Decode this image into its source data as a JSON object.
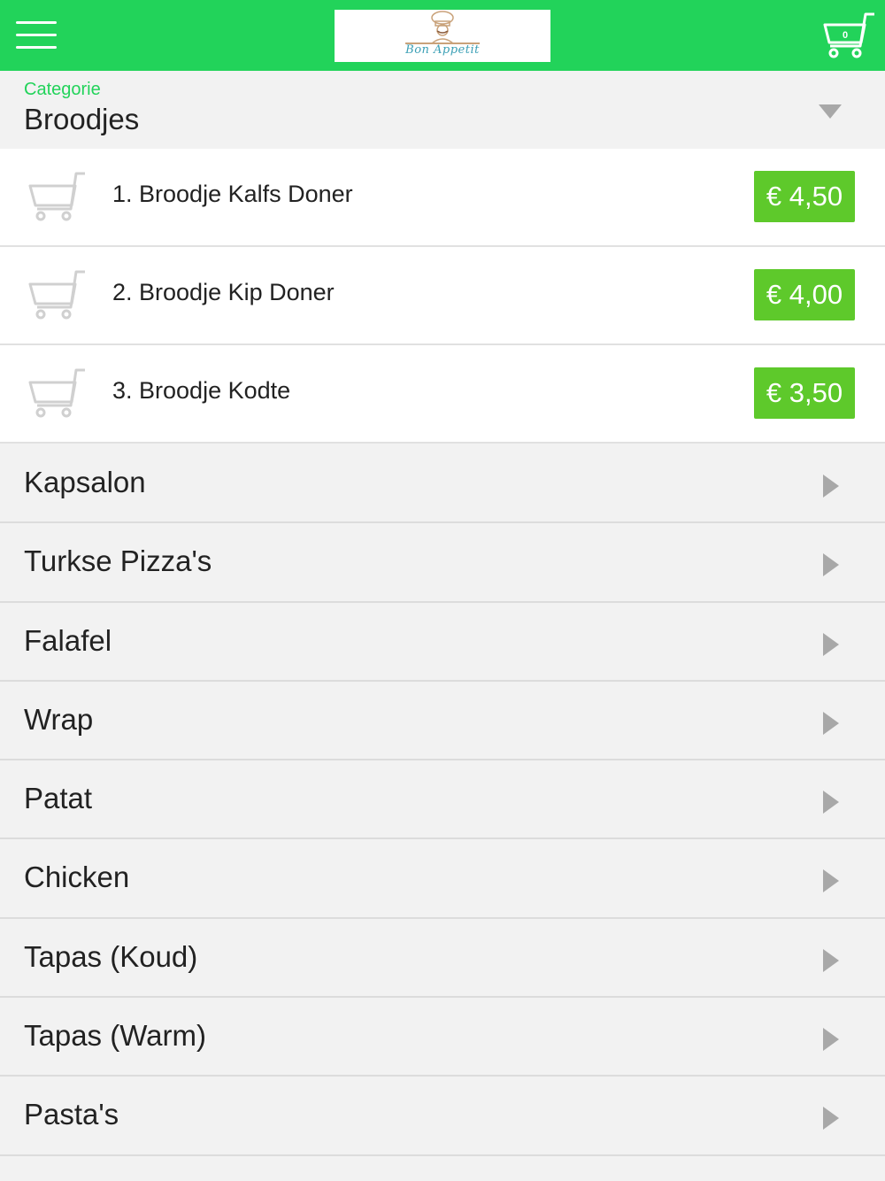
{
  "header": {
    "menu_icon": "hamburger-menu-icon",
    "logo_text": "Bon Appetit",
    "cart_icon": "shopping-cart-icon",
    "cart_count": "0",
    "brand_color": "#22d35a"
  },
  "category_select": {
    "label": "Categorie",
    "value": "Broodjes",
    "icon": "caret-down-icon"
  },
  "products": [
    {
      "name": "1. Broodje Kalfs Doner",
      "price": "€ 4,50"
    },
    {
      "name": "2. Broodje Kip Doner",
      "price": "€ 4,00"
    },
    {
      "name": "3. Broodje Kodte",
      "price": "€ 3,50"
    }
  ],
  "price_color": "#5ec92b",
  "categories": [
    {
      "label": "Kapsalon"
    },
    {
      "label": "Turkse Pizza's"
    },
    {
      "label": "Falafel"
    },
    {
      "label": "Wrap"
    },
    {
      "label": "Patat"
    },
    {
      "label": "Chicken"
    },
    {
      "label": "Tapas (Koud)"
    },
    {
      "label": "Tapas (Warm)"
    },
    {
      "label": "Pasta's"
    }
  ]
}
